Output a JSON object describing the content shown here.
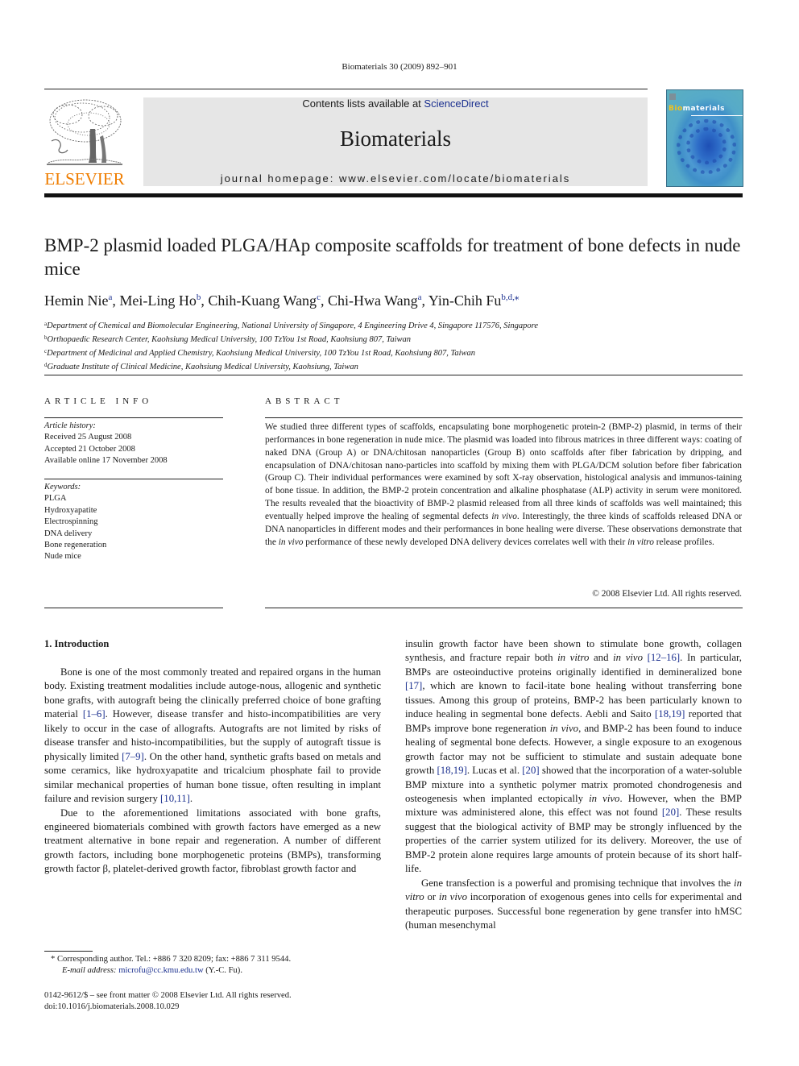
{
  "running_head": "Biomaterials 30 (2009) 892–901",
  "header": {
    "publisher_logo_text": "ELSEVIER",
    "contents_prefix": "Contents lists available at ",
    "contents_link": "ScienceDirect",
    "journal_name": "Biomaterials",
    "homepage_prefix": "journal homepage: ",
    "homepage_url": "www.elsevier.com/locate/biomaterials",
    "cover_title_highlight": "Bio",
    "cover_title_rest": "materials"
  },
  "colors": {
    "link": "#1a2f8f",
    "elsevier_orange": "#ef7d00",
    "band_gray": "#e6e6e6",
    "cover_yellow": "#f2c21b"
  },
  "article": {
    "title": "BMP-2 plasmid loaded PLGA/HAp composite scaffolds for treatment of bone defects in nude mice",
    "authors": [
      {
        "name": "Hemin Nie",
        "sup": "a",
        "sep": ", "
      },
      {
        "name": "Mei-Ling Ho",
        "sup": "b",
        "sep": ", "
      },
      {
        "name": "Chih-Kuang Wang",
        "sup": "c",
        "sep": ", "
      },
      {
        "name": "Chi-Hwa Wang",
        "sup": "a",
        "sep": ", "
      },
      {
        "name": "Yin-Chih Fu",
        "sup": "b,d,⁎",
        "sep": ""
      }
    ],
    "affiliations": [
      {
        "key": "a",
        "text": "Department of Chemical and Biomolecular Engineering, National University of Singapore, 4 Engineering Drive 4, Singapore 117576, Singapore"
      },
      {
        "key": "b",
        "text": "Orthopaedic Research Center, Kaohsiung Medical University, 100 TzYou 1st Road, Kaohsiung 807, Taiwan"
      },
      {
        "key": "c",
        "text": "Department of Medicinal and Applied Chemistry, Kaohsiung Medical University, 100 TzYou 1st Road, Kaohsiung 807, Taiwan"
      },
      {
        "key": "d",
        "text": "Graduate Institute of Clinical Medicine, Kaohsiung Medical University, Kaohsiung, Taiwan"
      }
    ]
  },
  "article_info": {
    "label": "ARTICLE INFO",
    "history_label": "Article history:",
    "history": [
      "Received 25 August 2008",
      "Accepted 21 October 2008",
      "Available online 17 November 2008"
    ],
    "keywords_label": "Keywords:",
    "keywords": [
      "PLGA",
      "Hydroxyapatite",
      "Electrospinning",
      "DNA delivery",
      "Bone regeneration",
      "Nude mice"
    ]
  },
  "abstract": {
    "label": "ABSTRACT",
    "parts": [
      {
        "t": "We studied three different types of scaffolds, encapsulating bone morphogenetic protein-2 (BMP-2) plasmid, in terms of their performances in bone regeneration in nude mice. The plasmid was loaded into fibrous matrices in three different ways: coating of naked DNA (Group A) or DNA/chitosan nanoparticles (Group B) onto scaffolds after fiber fabrication by dripping, and encapsulation of DNA/chitosan nano-particles into scaffold by mixing them with PLGA/DCM solution before fiber fabrication (Group C). Their individual performances were examined by soft X-ray observation, histological analysis and immunos-taining of bone tissue. In addition, the BMP-2 protein concentration and alkaline phosphatase (ALP) activity in serum were monitored. The results revealed that the bioactivity of BMP-2 plasmid released from all three kinds of scaffolds was well maintained; this eventually helped improve the healing of segmental defects ",
        "i": false
      },
      {
        "t": "in vivo",
        "i": true
      },
      {
        "t": ". Interestingly, the three kinds of scaffolds released DNA or DNA nanoparticles in different modes and their performances in bone healing were diverse. These observations demonstrate that the ",
        "i": false
      },
      {
        "t": "in vivo",
        "i": true
      },
      {
        "t": " performance of these newly developed DNA delivery devices correlates well with their ",
        "i": false
      },
      {
        "t": "in vitro",
        "i": true
      },
      {
        "t": " release profiles.",
        "i": false
      }
    ],
    "copyright": "© 2008 Elsevier Ltd. All rights reserved."
  },
  "body": {
    "intro_heading": "1.  Introduction",
    "left_paragraphs": [
      [
        {
          "t": "Bone is one of the most commonly treated and repaired organs in the human body. Existing treatment modalities include autoge-nous, allogenic and synthetic bone grafts, with autograft being the clinically preferred choice of bone grafting material "
        },
        {
          "t": "[1–6]",
          "c": true
        },
        {
          "t": ". However, disease transfer and histo-incompatibilities are very likely to occur in the case of allografts. Autografts are not limited by risks of disease transfer and histo-incompatibilities, but the supply of autograft tissue is physically limited "
        },
        {
          "t": "[7–9]",
          "c": true
        },
        {
          "t": ". On the other hand, synthetic grafts based on metals and some ceramics, like hydroxyapatite and tricalcium phosphate fail to provide similar mechanical properties of human bone tissue, often resulting in implant failure and revision surgery "
        },
        {
          "t": "[10,11]",
          "c": true
        },
        {
          "t": "."
        }
      ],
      [
        {
          "t": "Due to the aforementioned limitations associated with bone grafts, engineered biomaterials combined with growth factors have emerged as a new treatment alternative in bone repair and regeneration. A number of different growth factors, including bone morphogenetic proteins (BMPs), transforming growth factor β, platelet-derived growth factor, fibroblast growth factor and"
        }
      ]
    ],
    "right_paragraphs": [
      [
        {
          "t": "insulin growth factor have been shown to stimulate bone growth, collagen synthesis, and fracture repair both "
        },
        {
          "t": "in vitro",
          "i": true
        },
        {
          "t": " and "
        },
        {
          "t": "in vivo",
          "i": true
        },
        {
          "t": " "
        },
        {
          "t": "[12–16]",
          "c": true
        },
        {
          "t": ". In particular, BMPs are osteoinductive proteins originally identified in demineralized bone "
        },
        {
          "t": "[17]",
          "c": true
        },
        {
          "t": ", which are known to facil-itate bone healing without transferring bone tissues. Among this group of proteins, BMP-2 has been particularly known to induce healing in segmental bone defects. Aebli and Saito "
        },
        {
          "t": "[18,19]",
          "c": true
        },
        {
          "t": " reported that BMPs improve bone regeneration "
        },
        {
          "t": "in vivo",
          "i": true
        },
        {
          "t": ", and BMP-2 has been found to induce healing of segmental bone defects. However, a single exposure to an exogenous growth factor may not be sufficient to stimulate and sustain adequate bone growth "
        },
        {
          "t": "[18,19]",
          "c": true
        },
        {
          "t": ". Lucas et al. "
        },
        {
          "t": "[20]",
          "c": true
        },
        {
          "t": " showed that the incorporation of a water-soluble BMP mixture into a synthetic polymer matrix promoted chondrogenesis and osteogenesis when implanted ectopically "
        },
        {
          "t": "in vivo",
          "i": true
        },
        {
          "t": ". However, when the BMP mixture was administered alone, this effect was not found "
        },
        {
          "t": "[20]",
          "c": true
        },
        {
          "t": ". These results suggest that the biological activity of BMP may be strongly influenced by the properties of the carrier system utilized for its delivery. Moreover, the use of BMP-2 protein alone requires large amounts of protein because of its short half-life."
        }
      ],
      [
        {
          "t": "Gene transfection is a powerful and promising technique that involves the "
        },
        {
          "t": "in vitro",
          "i": true
        },
        {
          "t": " or "
        },
        {
          "t": "in vivo",
          "i": true
        },
        {
          "t": " incorporation of exogenous genes into cells for experimental and therapeutic purposes. Successful bone regeneration by gene transfer into hMSC (human mesenchymal"
        }
      ]
    ]
  },
  "footnote": {
    "marker": "*",
    "corresponding": " Corresponding author. Tel.: +886 7 320 8209; fax: +886 7 311 9544.",
    "email_label": "E-mail address:",
    "email": "microfu@cc.kmu.edu.tw",
    "email_suffix": " (Y.-C. Fu)."
  },
  "front_matter": {
    "issn_line": "0142-9612/$ – see front matter © 2008 Elsevier Ltd. All rights reserved.",
    "doi": "doi:10.1016/j.biomaterials.2008.10.029"
  }
}
